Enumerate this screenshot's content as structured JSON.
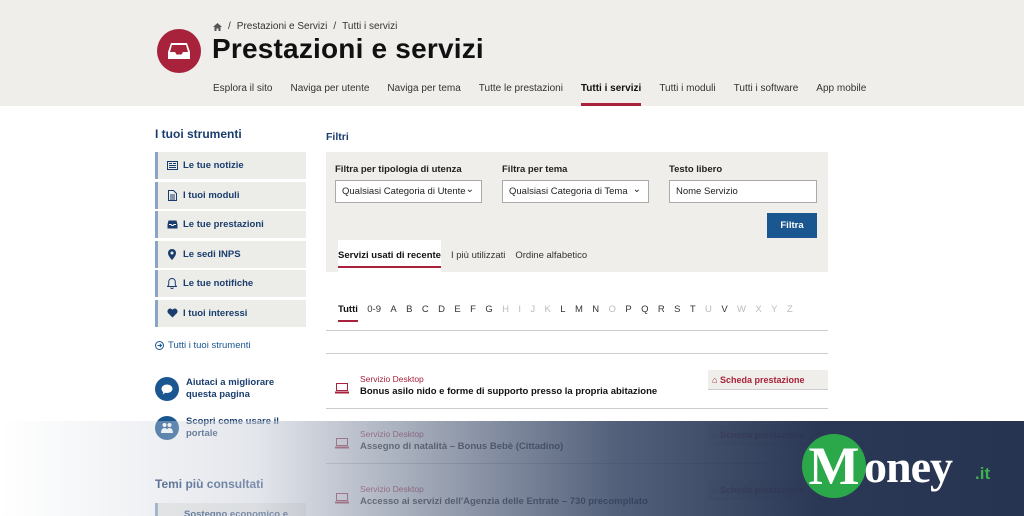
{
  "breadcrumb": {
    "home_icon": "home-icon",
    "sep": "/",
    "items": [
      "Prestazioni e Servizi",
      "Tutti i servizi"
    ]
  },
  "page": {
    "title": "Prestazioni e servizi",
    "logo_icon": "inbox-tray-icon",
    "accent": "#a8223b",
    "blue": "#1a5690"
  },
  "nav": [
    "Esplora il sito",
    "Naviga per utente",
    "Naviga per tema",
    "Tutte le prestazioni",
    "Tutti i servizi",
    "Tutti i moduli",
    "Tutti i software",
    "App mobile"
  ],
  "nav_active": "Tutti i servizi",
  "sidebar": {
    "title": "I tuoi strumenti",
    "tools": [
      {
        "label": "Le tue notizie",
        "icon": "newspaper-icon"
      },
      {
        "label": "I tuoi moduli",
        "icon": "document-icon"
      },
      {
        "label": "Le tue prestazioni",
        "icon": "inbox-icon"
      },
      {
        "label": "Le sedi INPS",
        "icon": "map-pin-icon"
      },
      {
        "label": "Le tue notifiche",
        "icon": "bell-icon"
      },
      {
        "label": "I tuoi interessi",
        "icon": "heart-icon"
      }
    ],
    "all_tools": "Tutti i tuoi strumenti",
    "help": [
      {
        "label": "Aiutaci a migliorare questa pagina",
        "icon": "chat-icon"
      },
      {
        "label": "Scopri come usare il portale",
        "icon": "people-icon"
      }
    ],
    "temi_title": "Temi più consultati",
    "temi_items": [
      "Sostegno economico e allo"
    ]
  },
  "filters": {
    "label": "Filtri",
    "tipologia": {
      "label": "Filtra per tipologia di utenza",
      "value": "Qualsiasi Categoria di Utente"
    },
    "tema": {
      "label": "Filtra per tema",
      "value": "Qualsiasi Categoria di Tema"
    },
    "testo": {
      "label": "Testo libero",
      "placeholder": "Nome Servizio"
    },
    "button": "Filtra"
  },
  "tabs": [
    "Servizi usati di recente",
    "I più utilizzati",
    "Ordine alfabetico"
  ],
  "tab_active": "Servizi usati di recente",
  "letters": {
    "all": [
      "Tutti",
      "0-9",
      "A",
      "B",
      "C",
      "D",
      "E",
      "F",
      "G",
      "H",
      "I",
      "J",
      "K",
      "L",
      "M",
      "N",
      "O",
      "P",
      "Q",
      "R",
      "S",
      "T",
      "U",
      "V",
      "W",
      "X",
      "Y",
      "Z"
    ],
    "disabled": [
      "H",
      "I",
      "J",
      "K",
      "O",
      "U",
      "W",
      "X",
      "Y",
      "Z"
    ],
    "current": "Tutti"
  },
  "services": [
    {
      "category": "Servizio Desktop",
      "name": "Bonus asilo nido e forme di supporto presso la propria abitazione",
      "card": "Scheda prestazione"
    },
    {
      "category": "Servizio Desktop",
      "name": "Assegno di natalità – Bonus Bebè (Cittadino)",
      "card": "Scheda prestazione"
    },
    {
      "category": "Servizio Desktop",
      "name": "Accesso ai servizi dell'Agenzia delle Entrate – 730 precompilato",
      "card": "Scheda prestazione"
    }
  ],
  "watermark": {
    "m": "M",
    "rest": "oney",
    "suffix": ".it",
    "brand_green": "#2aa84a"
  }
}
